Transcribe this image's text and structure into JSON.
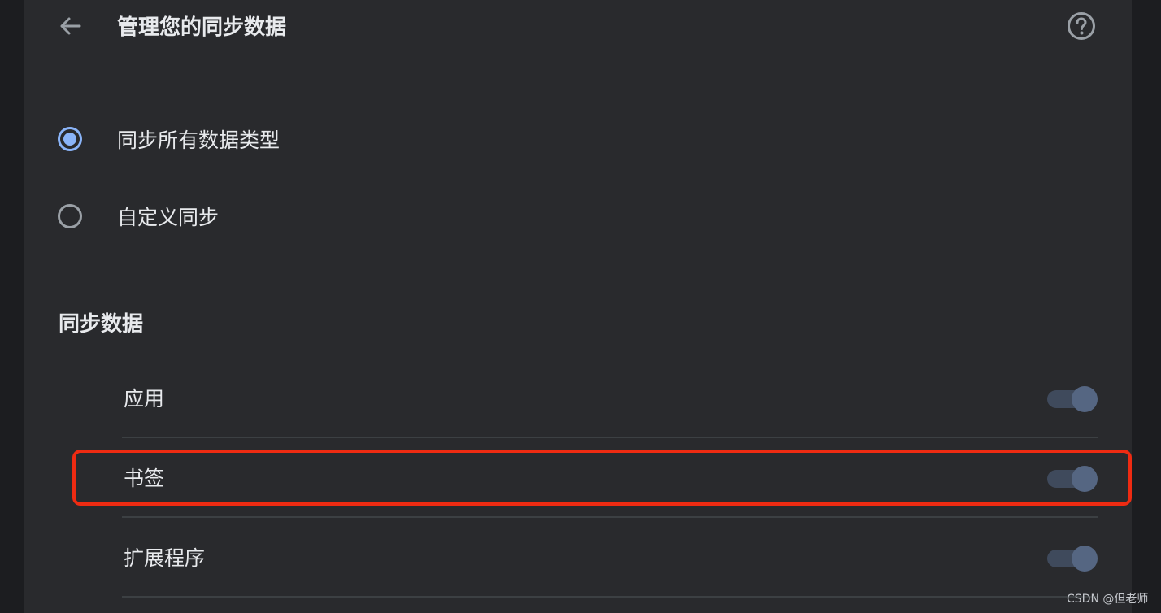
{
  "header": {
    "title": "管理您的同步数据",
    "back_icon": "arrow-back-icon",
    "help_icon": "help-circle-icon"
  },
  "sync_options": [
    {
      "label": "同步所有数据类型",
      "selected": true
    },
    {
      "label": "自定义同步",
      "selected": false
    }
  ],
  "section": {
    "title": "同步数据",
    "items": [
      {
        "label": "应用",
        "enabled": true
      },
      {
        "label": "书签",
        "enabled": true
      },
      {
        "label": "扩展程序",
        "enabled": true
      }
    ]
  },
  "annotation": {
    "highlighted_item": "书签",
    "color": "#ee2b12"
  },
  "watermark": "CSDN @但老师",
  "colors": {
    "background": "#292a2d",
    "accent": "#8ab4f8",
    "toggle_track": "#3f4a5c",
    "toggle_knob": "#556682"
  }
}
